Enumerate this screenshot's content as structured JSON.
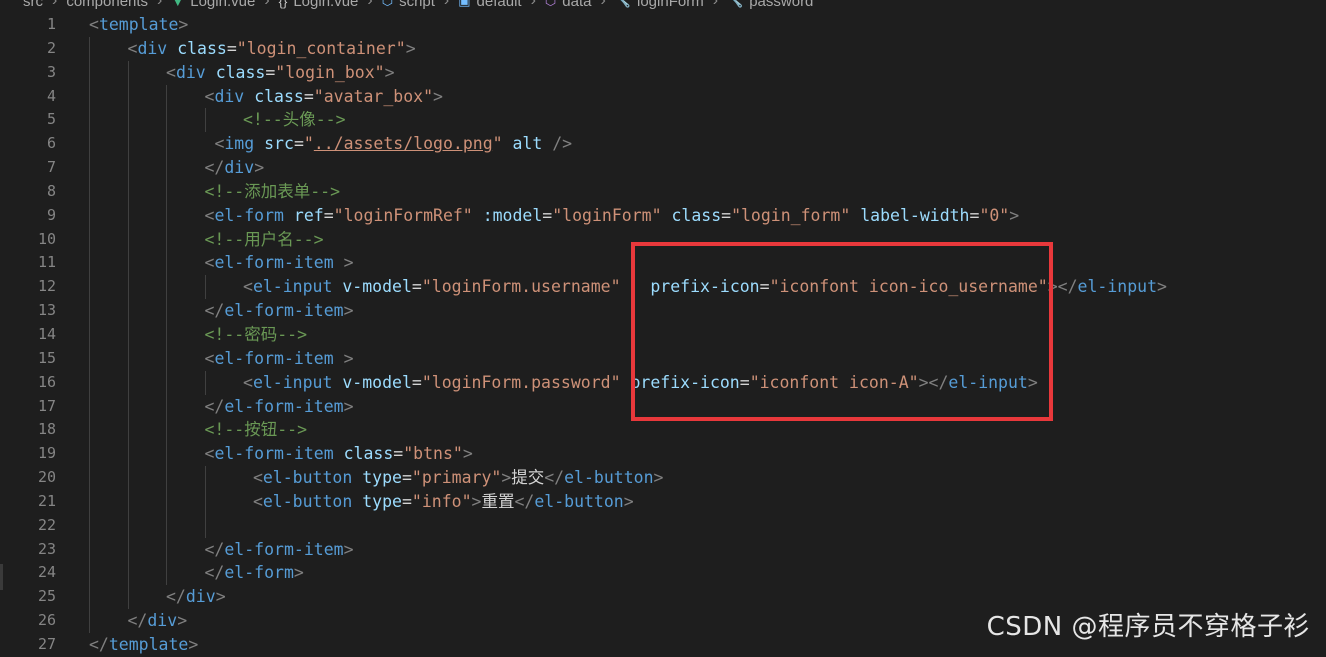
{
  "breadcrumb": {
    "items": [
      {
        "label": "src",
        "icon": "",
        "icon_name": ""
      },
      {
        "label": "components",
        "icon": "",
        "icon_name": ""
      },
      {
        "label": "Login.vue",
        "icon": "▼",
        "icon_name": "vue-file-icon",
        "icon_color": "#41b883"
      },
      {
        "label": "Login.vue",
        "icon": "{}",
        "icon_name": "braces-icon",
        "icon_color": "#c5c5c5"
      },
      {
        "label": "script",
        "icon": "⬡",
        "icon_name": "module-icon",
        "icon_color": "#75beff"
      },
      {
        "label": "default",
        "icon": "▣",
        "icon_name": "symbol-object-icon",
        "icon_color": "#75beff"
      },
      {
        "label": "data",
        "icon": "⬡",
        "icon_name": "method-icon",
        "icon_color": "#b180d7"
      },
      {
        "label": "loginForm",
        "icon": "🔧",
        "icon_name": "property-icon",
        "icon_color": "#c5c5c5"
      },
      {
        "label": "password",
        "icon": "🔧",
        "icon_name": "property-icon",
        "icon_color": "#c5c5c5"
      }
    ]
  },
  "editor": {
    "lines": [
      {
        "n": "1",
        "indent": 0,
        "tokens": [
          [
            "pun",
            "<"
          ],
          [
            "tag",
            "template"
          ],
          [
            "pun",
            ">"
          ]
        ]
      },
      {
        "n": "2",
        "indent": 1,
        "tokens": [
          [
            "pun",
            "<"
          ],
          [
            "tag",
            "div"
          ],
          [
            "txt",
            " "
          ],
          [
            "attr",
            "class"
          ],
          [
            "txt",
            "="
          ],
          [
            "str",
            "\"login_container\""
          ],
          [
            "pun",
            ">"
          ]
        ]
      },
      {
        "n": "3",
        "indent": 2,
        "tokens": [
          [
            "pun",
            "<"
          ],
          [
            "tag",
            "div"
          ],
          [
            "txt",
            " "
          ],
          [
            "attr",
            "class"
          ],
          [
            "txt",
            "="
          ],
          [
            "str",
            "\"login_box\""
          ],
          [
            "pun",
            ">"
          ]
        ]
      },
      {
        "n": "4",
        "indent": 3,
        "tokens": [
          [
            "pun",
            "<"
          ],
          [
            "tag",
            "div"
          ],
          [
            "txt",
            " "
          ],
          [
            "attr",
            "class"
          ],
          [
            "txt",
            "="
          ],
          [
            "str",
            "\"avatar_box\""
          ],
          [
            "pun",
            ">"
          ]
        ]
      },
      {
        "n": "5",
        "indent": 4,
        "tokens": [
          [
            "cmt",
            "<!--头像-->"
          ]
        ]
      },
      {
        "n": "6",
        "indent": 3,
        "tokens": [
          [
            "txt",
            " "
          ],
          [
            "pun",
            "<"
          ],
          [
            "tag",
            "img"
          ],
          [
            "txt",
            " "
          ],
          [
            "attr",
            "src"
          ],
          [
            "txt",
            "="
          ],
          [
            "str",
            "\""
          ],
          [
            "link",
            "../assets/logo.png"
          ],
          [
            "str",
            "\""
          ],
          [
            "txt",
            " "
          ],
          [
            "attr",
            "alt"
          ],
          [
            "txt",
            " "
          ],
          [
            "pun",
            "/>"
          ]
        ]
      },
      {
        "n": "7",
        "indent": 3,
        "tokens": [
          [
            "pun",
            "</"
          ],
          [
            "tag",
            "div"
          ],
          [
            "pun",
            ">"
          ]
        ]
      },
      {
        "n": "8",
        "indent": 3,
        "tokens": [
          [
            "cmt",
            "<!--添加表单-->"
          ]
        ]
      },
      {
        "n": "9",
        "indent": 3,
        "tokens": [
          [
            "pun",
            "<"
          ],
          [
            "tag",
            "el-form"
          ],
          [
            "txt",
            " "
          ],
          [
            "attr",
            "ref"
          ],
          [
            "txt",
            "="
          ],
          [
            "str",
            "\"loginFormRef\""
          ],
          [
            "txt",
            " "
          ],
          [
            "attr",
            ":model"
          ],
          [
            "txt",
            "="
          ],
          [
            "str",
            "\"loginForm\""
          ],
          [
            "txt",
            " "
          ],
          [
            "attr",
            "class"
          ],
          [
            "txt",
            "="
          ],
          [
            "str",
            "\"login_form\""
          ],
          [
            "txt",
            " "
          ],
          [
            "attr",
            "label-width"
          ],
          [
            "txt",
            "="
          ],
          [
            "str",
            "\"0\""
          ],
          [
            "pun",
            ">"
          ]
        ]
      },
      {
        "n": "10",
        "indent": 3,
        "tokens": [
          [
            "cmt",
            "<!--用户名-->"
          ]
        ]
      },
      {
        "n": "11",
        "indent": 3,
        "tokens": [
          [
            "pun",
            "<"
          ],
          [
            "tag",
            "el-form-item"
          ],
          [
            "txt",
            " "
          ],
          [
            "pun",
            ">"
          ]
        ]
      },
      {
        "n": "12",
        "indent": 4,
        "tokens": [
          [
            "pun",
            "<"
          ],
          [
            "tag",
            "el-input"
          ],
          [
            "txt",
            " "
          ],
          [
            "attr",
            "v-model"
          ],
          [
            "txt",
            "="
          ],
          [
            "str",
            "\"loginForm.username\""
          ],
          [
            "txt",
            "   "
          ],
          [
            "attr",
            "prefix-icon"
          ],
          [
            "txt",
            "="
          ],
          [
            "str",
            "\"iconfont icon-ico_username\""
          ],
          [
            "pun",
            "></"
          ],
          [
            "tag",
            "el-input"
          ],
          [
            "pun",
            ">"
          ]
        ]
      },
      {
        "n": "13",
        "indent": 3,
        "tokens": [
          [
            "pun",
            "</"
          ],
          [
            "tag",
            "el-form-item"
          ],
          [
            "pun",
            ">"
          ]
        ]
      },
      {
        "n": "14",
        "indent": 3,
        "tokens": [
          [
            "cmt",
            "<!--密码-->"
          ]
        ]
      },
      {
        "n": "15",
        "indent": 3,
        "tokens": [
          [
            "pun",
            "<"
          ],
          [
            "tag",
            "el-form-item"
          ],
          [
            "txt",
            " "
          ],
          [
            "pun",
            ">"
          ]
        ]
      },
      {
        "n": "16",
        "indent": 4,
        "tokens": [
          [
            "pun",
            "<"
          ],
          [
            "tag",
            "el-input"
          ],
          [
            "txt",
            " "
          ],
          [
            "attr",
            "v-model"
          ],
          [
            "txt",
            "="
          ],
          [
            "str",
            "\"loginForm.password\""
          ],
          [
            "txt",
            " "
          ],
          [
            "attr",
            "prefix-icon"
          ],
          [
            "txt",
            "="
          ],
          [
            "str",
            "\"iconfont icon-A\""
          ],
          [
            "pun",
            "></"
          ],
          [
            "tag",
            "el-input"
          ],
          [
            "pun",
            ">"
          ]
        ]
      },
      {
        "n": "17",
        "indent": 3,
        "tokens": [
          [
            "pun",
            "</"
          ],
          [
            "tag",
            "el-form-item"
          ],
          [
            "pun",
            ">"
          ]
        ]
      },
      {
        "n": "18",
        "indent": 3,
        "tokens": [
          [
            "cmt",
            "<!--按钮-->"
          ]
        ]
      },
      {
        "n": "19",
        "indent": 3,
        "tokens": [
          [
            "pun",
            "<"
          ],
          [
            "tag",
            "el-form-item"
          ],
          [
            "txt",
            " "
          ],
          [
            "attr",
            "class"
          ],
          [
            "txt",
            "="
          ],
          [
            "str",
            "\"btns\""
          ],
          [
            "pun",
            ">"
          ]
        ]
      },
      {
        "n": "20",
        "indent": 4,
        "tokens": [
          [
            "txt",
            " "
          ],
          [
            "pun",
            "<"
          ],
          [
            "tag",
            "el-button"
          ],
          [
            "txt",
            " "
          ],
          [
            "attr",
            "type"
          ],
          [
            "txt",
            "="
          ],
          [
            "str",
            "\"primary\""
          ],
          [
            "pun",
            ">"
          ],
          [
            "txt",
            "提交"
          ],
          [
            "pun",
            "</"
          ],
          [
            "tag",
            "el-button"
          ],
          [
            "pun",
            ">"
          ]
        ]
      },
      {
        "n": "21",
        "indent": 4,
        "tokens": [
          [
            "txt",
            " "
          ],
          [
            "pun",
            "<"
          ],
          [
            "tag",
            "el-button"
          ],
          [
            "txt",
            " "
          ],
          [
            "attr",
            "type"
          ],
          [
            "txt",
            "="
          ],
          [
            "str",
            "\"info\""
          ],
          [
            "pun",
            ">"
          ],
          [
            "txt",
            "重置"
          ],
          [
            "pun",
            "</"
          ],
          [
            "tag",
            "el-button"
          ],
          [
            "pun",
            ">"
          ]
        ]
      },
      {
        "n": "22",
        "indent": 4,
        "tokens": []
      },
      {
        "n": "23",
        "indent": 3,
        "tokens": [
          [
            "pun",
            "</"
          ],
          [
            "tag",
            "el-form-item"
          ],
          [
            "pun",
            ">"
          ]
        ]
      },
      {
        "n": "24",
        "indent": 3,
        "tokens": [
          [
            "pun",
            "</"
          ],
          [
            "tag",
            "el-form"
          ],
          [
            "pun",
            ">"
          ]
        ]
      },
      {
        "n": "25",
        "indent": 2,
        "tokens": [
          [
            "pun",
            "</"
          ],
          [
            "tag",
            "div"
          ],
          [
            "pun",
            ">"
          ]
        ]
      },
      {
        "n": "26",
        "indent": 1,
        "tokens": [
          [
            "pun",
            "</"
          ],
          [
            "tag",
            "div"
          ],
          [
            "pun",
            ">"
          ]
        ]
      },
      {
        "n": "27",
        "indent": 0,
        "tokens": [
          [
            "pun",
            "</"
          ],
          [
            "tag",
            "template"
          ],
          [
            "pun",
            ">"
          ]
        ]
      }
    ]
  },
  "watermark": {
    "text": "CSDN @程序员不穿格子衫"
  },
  "colors": {
    "background": "#1e1e1e",
    "tag": "#569cd6",
    "attribute": "#9cdcfe",
    "string": "#ce9178",
    "comment": "#6a9955",
    "punctuation": "#808080",
    "line_number": "#858585",
    "highlight_box": "#e8383b"
  }
}
